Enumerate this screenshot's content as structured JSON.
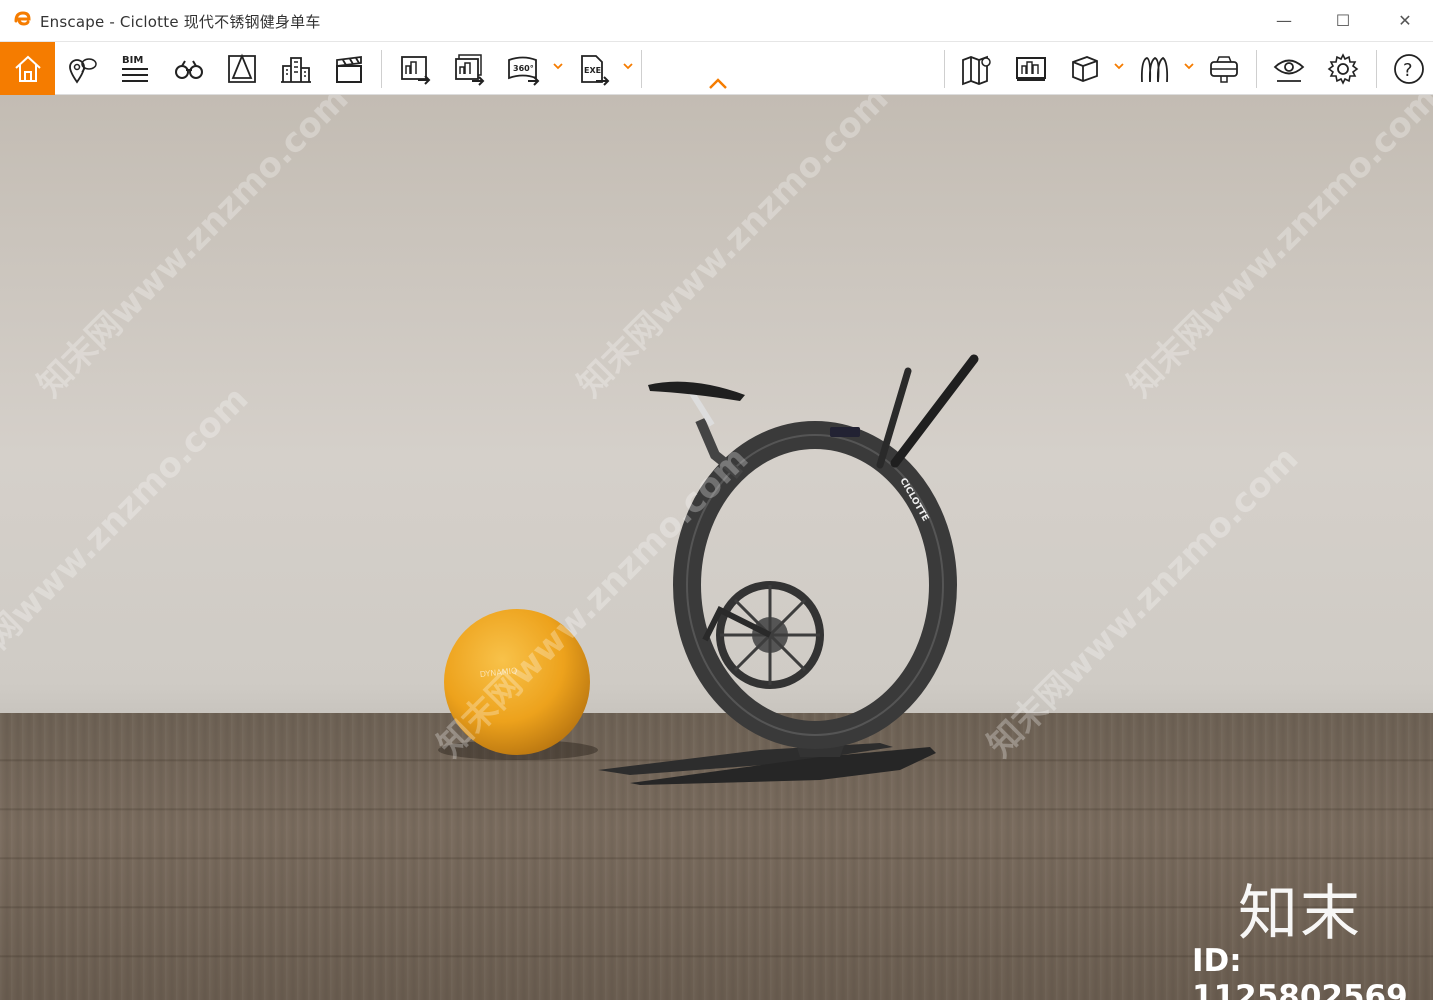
{
  "window": {
    "title": "Enscape - Ciclotte 现代不锈钢健身单车",
    "minimize_glyph": "—",
    "maximize_glyph": "☐",
    "close_glyph": "✕"
  },
  "toolbar": {
    "accent_color": "#f57c00",
    "items": [
      {
        "name": "home-icon"
      },
      {
        "name": "location-icon"
      },
      {
        "name": "bim-icon",
        "label": "BIM"
      },
      {
        "name": "binoculars-icon"
      },
      {
        "name": "perspective-icon"
      },
      {
        "name": "buildings-icon"
      },
      {
        "name": "clapperboard-icon"
      },
      {
        "name": "render-image-icon"
      },
      {
        "name": "batch-render-icon"
      },
      {
        "name": "panorama-360-icon",
        "label": "360°"
      },
      {
        "name": "export-exe-icon",
        "label": "EXE"
      },
      {
        "name": "map-icon"
      },
      {
        "name": "monitor-icon"
      },
      {
        "name": "cube-icon"
      },
      {
        "name": "asset-library-icon"
      },
      {
        "name": "vr-headset-icon"
      },
      {
        "name": "eye-icon"
      },
      {
        "name": "settings-gear-icon"
      },
      {
        "name": "help-icon",
        "label": "?"
      }
    ]
  },
  "viewport": {
    "watermark_text": "知末网www.znzmo.com",
    "brand_mark": "知末",
    "id_label": "ID: 1125802569",
    "bike_brand": "CICLOTTE",
    "ball_brand": "DYNAMIQ",
    "ball_color": "#f2a81e"
  }
}
